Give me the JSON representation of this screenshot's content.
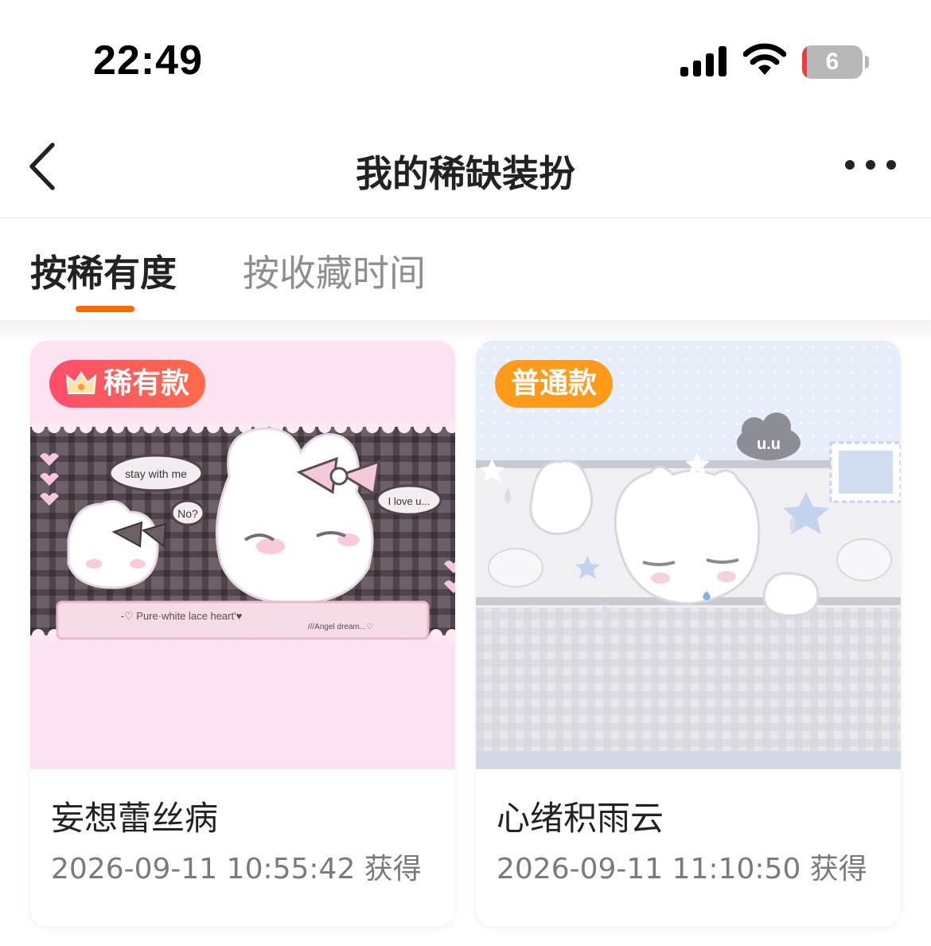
{
  "status_bar": {
    "time": "22:49",
    "battery_level": "6",
    "battery_fraction": 0.06,
    "icons": [
      "signal-icon",
      "wifi-icon",
      "battery-icon"
    ]
  },
  "nav": {
    "title": "我的稀缺装扮",
    "back_icon": "chevron-left-icon",
    "more_icon": "more-dots-icon"
  },
  "tabs": [
    {
      "label": "按稀有度",
      "active": true
    },
    {
      "label": "按收藏时间",
      "active": false
    }
  ],
  "colors": {
    "accent": "#ff6a00",
    "rare_badge": "#ff4d6d",
    "common_badge": "#ff9a1a",
    "card1_bg": "#fde3f2",
    "card2_bg": "#e6eefb"
  },
  "items": [
    {
      "badge": "稀有款",
      "badge_icon": "crown-icon",
      "name": "妄想蕾丝病",
      "date": "2026-09-11 10:55:42 获得",
      "artwork_text": {
        "bubble_1": "stay with me",
        "bubble_2": "No?",
        "bubble_3": "I love u...",
        "banner": "-♡ Pure·white lace heart'♥",
        "banner_2": "///Angel dream...♡"
      }
    },
    {
      "badge": "普通款",
      "name": "心绪积雨云",
      "date": "2026-09-11 11:10:50 获得",
      "artwork_text": {
        "cloud_face": "u.u"
      }
    }
  ]
}
